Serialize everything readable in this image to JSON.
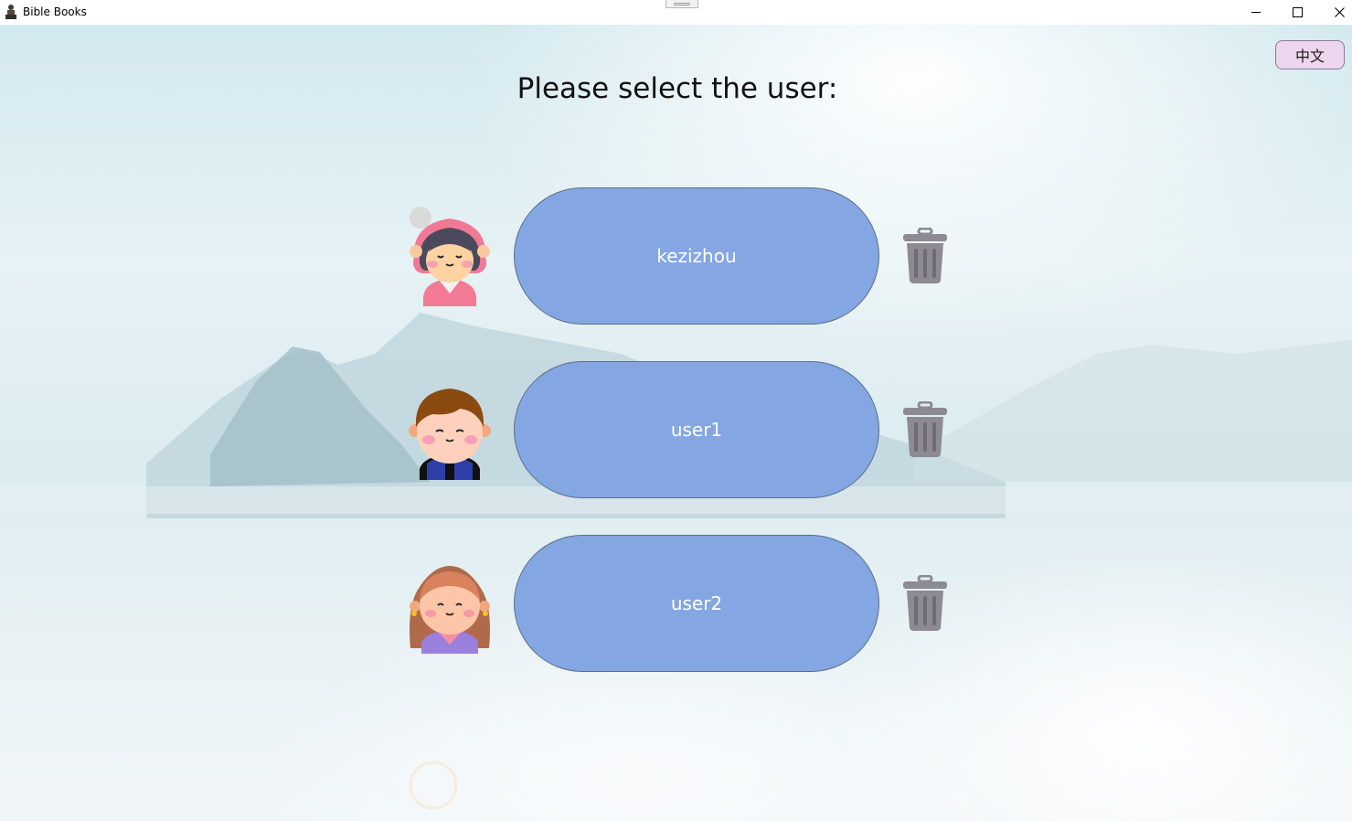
{
  "window": {
    "title": "Bible Books"
  },
  "language_button": {
    "label": "中文"
  },
  "heading": "Please select the user:",
  "users": [
    {
      "name": "kezizhou",
      "avatar": "girl-pink-hood-avatar"
    },
    {
      "name": "user1",
      "avatar": "boy-brown-hair-avatar"
    },
    {
      "name": "user2",
      "avatar": "girl-long-hair-avatar"
    }
  ],
  "colors": {
    "pill": "#84a6e2",
    "language_button": "#ecd6ee",
    "trash": "#8d8a93"
  }
}
